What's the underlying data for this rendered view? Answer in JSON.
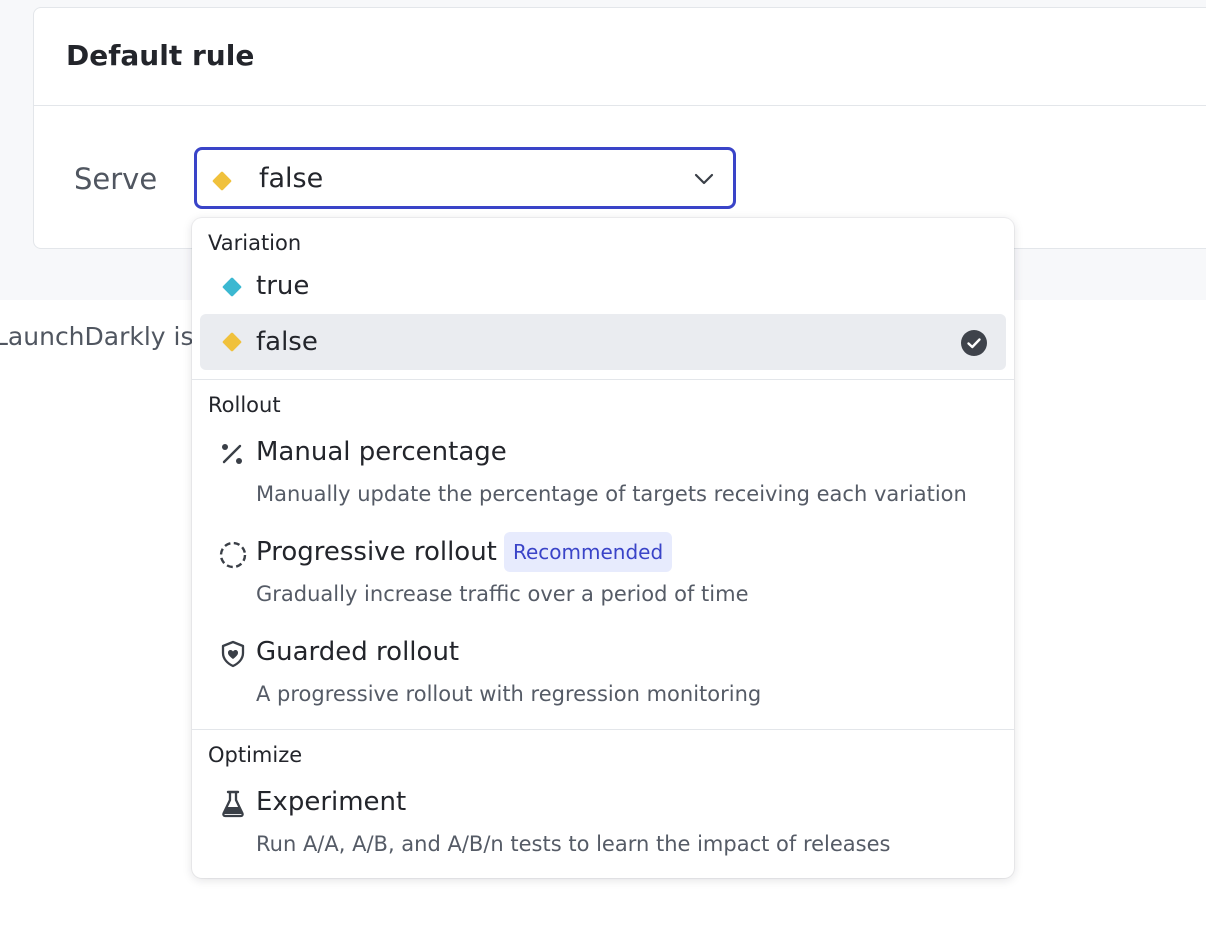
{
  "card": {
    "title": "Default rule",
    "serve_label": "Serve",
    "selected_value": "false"
  },
  "background_text": "LaunchDarkly is",
  "menu": {
    "groups": [
      {
        "label": "Variation",
        "items": [
          {
            "label": "true",
            "icon": "diamond-icon",
            "color": "#3bb8d1"
          },
          {
            "label": "false",
            "icon": "diamond-icon",
            "color": "#f0c13c",
            "selected": true
          }
        ]
      },
      {
        "label": "Rollout",
        "items": [
          {
            "label": "Manual percentage",
            "icon": "percent-icon",
            "description": "Manually update the percentage of targets receiving each variation"
          },
          {
            "label": "Progressive rollout",
            "icon": "dashed-circle-icon",
            "badge": "Recommended",
            "description": "Gradually increase traffic over a period of time"
          },
          {
            "label": "Guarded rollout",
            "icon": "shield-heart-icon",
            "description": "A progressive rollout with regression monitoring"
          }
        ]
      },
      {
        "label": "Optimize",
        "items": [
          {
            "label": "Experiment",
            "icon": "flask-icon",
            "description": "Run A/A, A/B, and A/B/n tests to learn the impact of releases"
          }
        ]
      }
    ]
  },
  "colors": {
    "accent": "#3a44c8",
    "true_variation": "#3bb8d1",
    "false_variation": "#f0c13c",
    "badge_bg": "#e7ebfd"
  }
}
